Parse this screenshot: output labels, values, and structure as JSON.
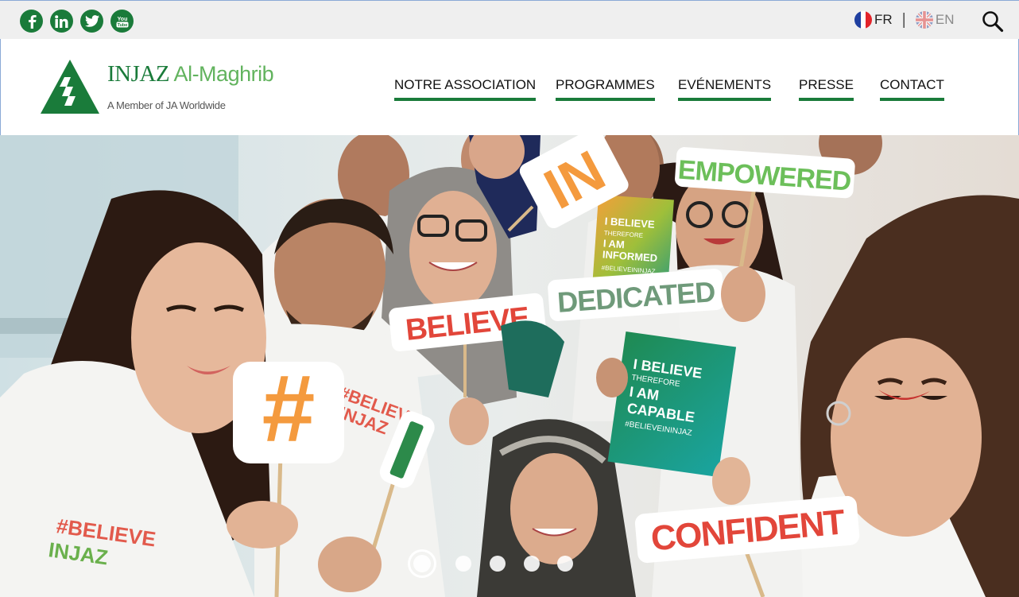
{
  "topbar": {
    "social": [
      {
        "name": "facebook-icon",
        "glyph": "f"
      },
      {
        "name": "linkedin-icon",
        "glyph": "in"
      },
      {
        "name": "twitter-icon",
        "glyph": ""
      },
      {
        "name": "youtube-icon",
        "glyph": "You"
      }
    ],
    "lang_fr": "FR",
    "lang_separator": "|",
    "lang_en": "EN"
  },
  "logo": {
    "name_main": "INJAZ",
    "name_suffix": " Al-Maghrib",
    "tagline": "A Member of JA Worldwide"
  },
  "nav": {
    "items": [
      {
        "label": "NOTRE ASSOCIATION"
      },
      {
        "label": "PROGRAMMES"
      },
      {
        "label": "EVÉNEMENTS"
      },
      {
        "label": "PRESSE"
      },
      {
        "label": "CONTACT"
      }
    ]
  },
  "hero": {
    "signs": {
      "empowered": "EMPOWERED",
      "in": "IN",
      "believe": "BELIEVE",
      "dedicated": "DEDICATED",
      "confident": "CONFIDENT",
      "hash": "#",
      "slash": "/"
    },
    "card_top": [
      "I BELIEVE",
      "THEREFORE",
      "I AM",
      "INFORMED",
      "#BELIEVEININJAZ"
    ],
    "card_bottom": [
      "I BELIEVE",
      "THEREFORE",
      "I AM",
      "CAPABLE",
      "#BELIEVEININJAZ"
    ],
    "shirt_text": [
      "#BELIEVE",
      "INJAZ"
    ],
    "slider_count": 5,
    "slider_active": 1
  },
  "colors": {
    "brand_green": "#1a7b3a",
    "brand_light_green": "#62b35e",
    "topbar_bg": "#efefef",
    "sign_red": "#e2463a",
    "sign_orange": "#f49a3e"
  }
}
